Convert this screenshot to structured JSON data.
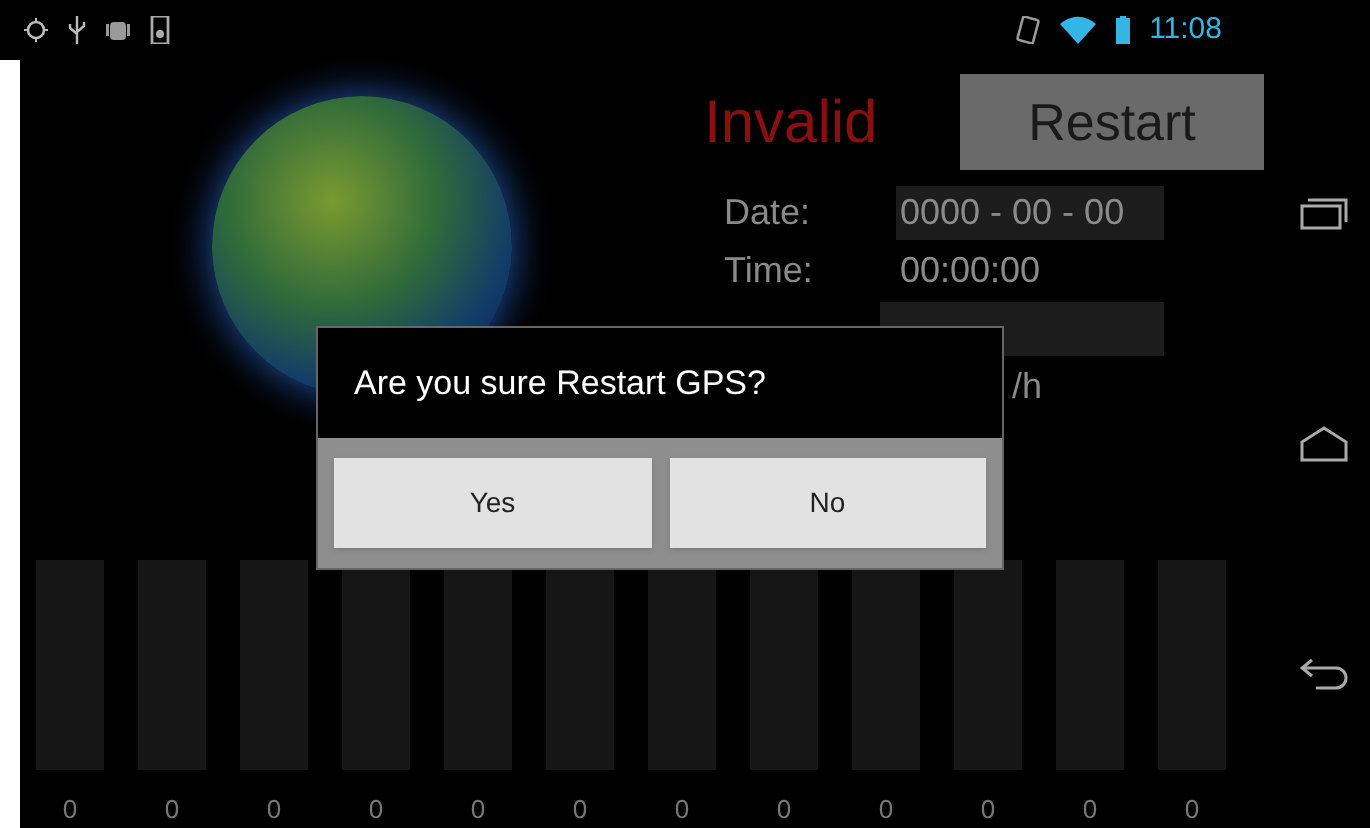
{
  "status_bar": {
    "time": "11:08"
  },
  "gps": {
    "status": "Invalid",
    "restart_button": "Restart",
    "rows": [
      {
        "label": "Date:",
        "value": "0000 - 00 - 00"
      },
      {
        "label": "Time:",
        "value": "00:00:00"
      },
      {
        "value": "/h"
      }
    ]
  },
  "dialog": {
    "message": "Are you sure Restart GPS?",
    "buttons": [
      "Yes",
      "No"
    ]
  },
  "satellites": [
    {
      "level": 0,
      "reading": "0"
    },
    {
      "level": 0,
      "reading": "0"
    },
    {
      "level": 0,
      "reading": "0"
    },
    {
      "level": 0,
      "reading": "0"
    },
    {
      "level": 0,
      "reading": "0"
    },
    {
      "level": 0,
      "reading": "0"
    },
    {
      "level": 0,
      "reading": "0"
    },
    {
      "level": 0,
      "reading": "0"
    },
    {
      "level": 0,
      "reading": "0"
    },
    {
      "level": 0,
      "reading": "0"
    },
    {
      "level": 0,
      "reading": "0"
    },
    {
      "level": 0,
      "reading": "0"
    }
  ]
}
